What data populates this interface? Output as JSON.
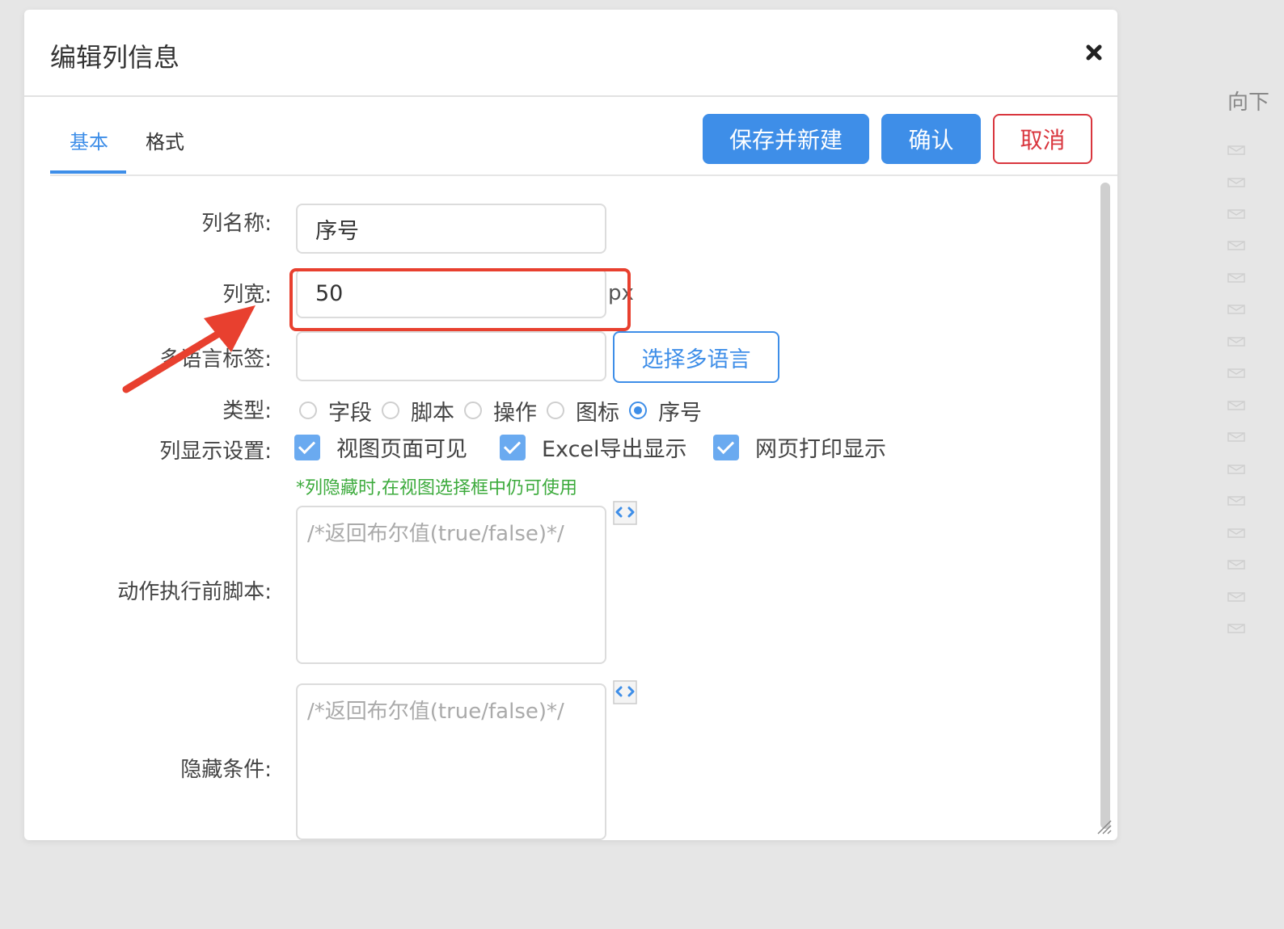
{
  "background": {
    "side_label": "向下"
  },
  "dialog": {
    "title": "编辑列信息",
    "tabs": [
      {
        "label": "基本",
        "active": true
      },
      {
        "label": "格式",
        "active": false
      }
    ],
    "buttons": {
      "save_new": "保存并新建",
      "confirm": "确认",
      "cancel": "取消"
    },
    "form": {
      "column_name": {
        "label": "列名称:",
        "value": "序号"
      },
      "column_width": {
        "label": "列宽:",
        "value": "50",
        "unit": "px"
      },
      "i18n_tag": {
        "label": "多语言标签:",
        "value": "",
        "button": "选择多语言"
      },
      "type": {
        "label": "类型:",
        "options": [
          "字段",
          "脚本",
          "操作",
          "图标",
          "序号"
        ],
        "selected": "序号"
      },
      "display": {
        "label": "列显示设置:",
        "options": [
          {
            "label": "视图页面可见",
            "checked": true
          },
          {
            "label": "Excel导出显示",
            "checked": true
          },
          {
            "label": "网页打印显示",
            "checked": true
          }
        ],
        "hint": "*列隐藏时,在视图选择框中仍可使用"
      },
      "pre_action_script": {
        "label": "动作执行前脚本:",
        "placeholder": "/*返回布尔值(true/false)*/"
      },
      "hide_condition": {
        "label": "隐藏条件:",
        "placeholder": "/*返回布尔值(true/false)*/"
      }
    }
  },
  "colors": {
    "primary": "#3e8ee8",
    "danger": "#d9363e",
    "hint": "#3dab3d",
    "annotation": "#e8402f"
  }
}
